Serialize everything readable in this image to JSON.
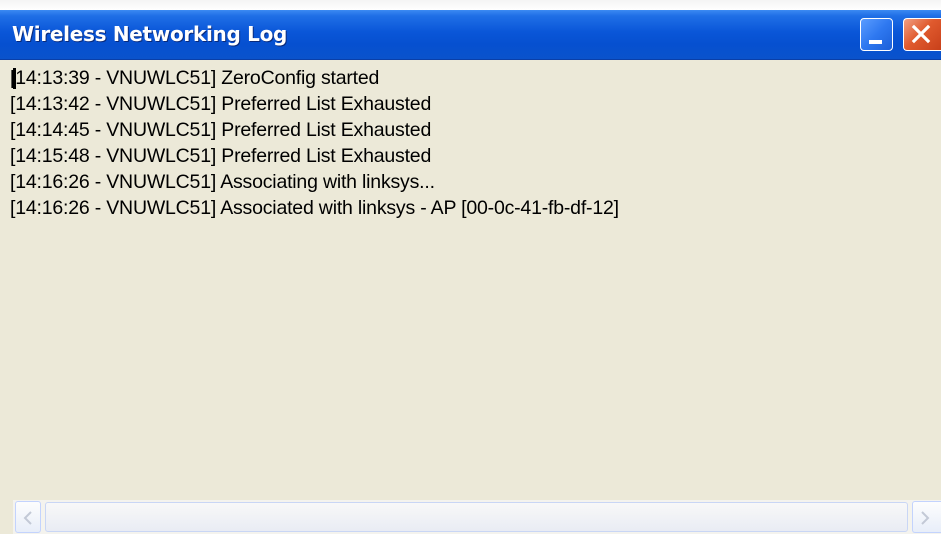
{
  "window": {
    "title": "Wireless Networking Log"
  },
  "titlebar_buttons": {
    "minimize_icon": "minimize-icon",
    "close_icon": "close-icon"
  },
  "log": {
    "entries": [
      "[14:13:39 - VNUWLC51] ZeroConfig started",
      "[14:13:42 - VNUWLC51] Preferred List Exhausted",
      "[14:14:45 - VNUWLC51] Preferred List Exhausted",
      "[14:15:48 - VNUWLC51] Preferred List Exhausted",
      "[14:16:26 - VNUWLC51] Associating with linksys...",
      "[14:16:26 - VNUWLC51] Associated with linksys - AP [00-0c-41-fb-df-12]"
    ]
  },
  "scrollbar": {
    "left_icon": "scroll-left-icon",
    "right_icon": "scroll-right-icon"
  },
  "colors": {
    "titlebar": "#0a56d8",
    "window_bg": "#ece9d8",
    "close_button": "#e05a2e",
    "title_text": "#ffffff"
  }
}
